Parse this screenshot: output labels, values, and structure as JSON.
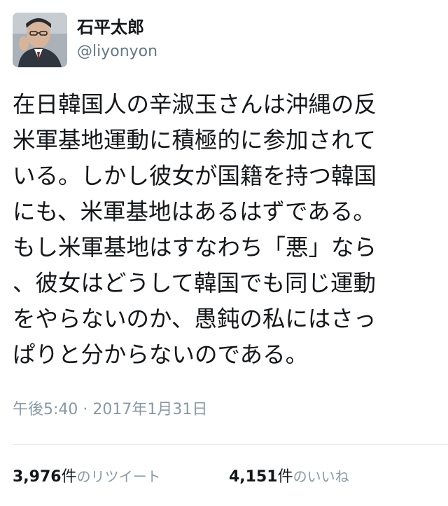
{
  "user": {
    "display_name": "石平太郎",
    "handle": "@liyonyon"
  },
  "tweet": {
    "lines": [
      "在日韓国人の辛淑玉さんは沖縄の反",
      "米軍基地運動に積極的に参加されて",
      "いる。しかし彼女が国籍を持つ韓国",
      "にも、米軍基地はあるはずである。",
      "もし米軍基地はすなわち「悪」なら",
      "、彼女はどうして韓国でも同じ運動",
      "をやらないのか、愚鈍の私にはさっ",
      "ぱりと分からないのである。"
    ],
    "timestamp": "午後5:40 · 2017年1月31日"
  },
  "stats": {
    "retweets": {
      "count": "3,976",
      "unit": "件",
      "label": "のリツイート"
    },
    "likes": {
      "count": "4,151",
      "unit": "件",
      "label": "のいいね"
    }
  },
  "icons": {
    "avatar": "profile-photo"
  },
  "colors": {
    "text": "#14171a",
    "secondary": "#657786",
    "muted": "#8899a6",
    "divider": "#e1e8ed"
  }
}
